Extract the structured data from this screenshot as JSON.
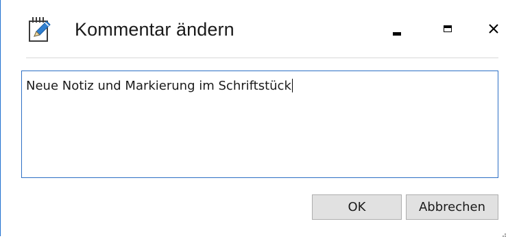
{
  "window": {
    "title": "Kommentar ändern",
    "icon": "edit-note-icon",
    "controls": {
      "minimize": "minimize-icon",
      "maximize": "maximize-icon",
      "close": "close-icon"
    }
  },
  "comment": {
    "value": "Neue Notiz und Markierung im Schriftstück"
  },
  "buttons": {
    "ok_label": "OK",
    "cancel_label": "Abbrechen"
  },
  "colors": {
    "focus_border": "#2b6ec4",
    "button_face": "#e1e1e1",
    "window_border": "#1e6fd0"
  }
}
